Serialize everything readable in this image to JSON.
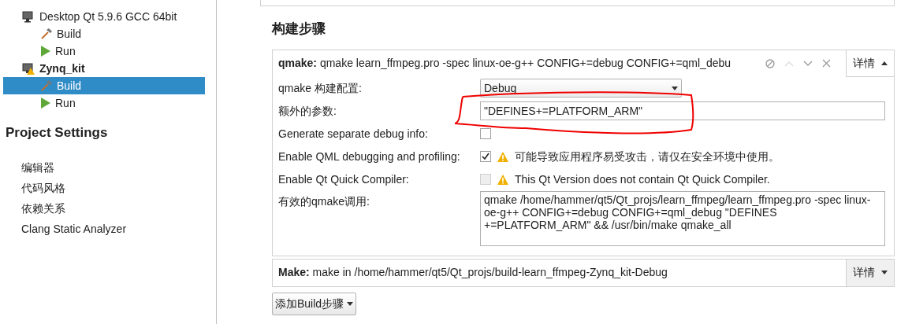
{
  "sidebar": {
    "kits": [
      {
        "name": "Desktop Qt 5.9.6 GCC 64bit",
        "warning": false,
        "bold": false,
        "children": [
          {
            "label": "Build",
            "kind": "build",
            "selected": false
          },
          {
            "label": "Run",
            "kind": "run",
            "selected": false
          }
        ]
      },
      {
        "name": "Zynq_kit",
        "warning": true,
        "bold": true,
        "children": [
          {
            "label": "Build",
            "kind": "build",
            "selected": true
          },
          {
            "label": "Run",
            "kind": "run",
            "selected": false
          }
        ]
      }
    ],
    "settings_title": "Project Settings",
    "settings_items": [
      {
        "label": "编辑器"
      },
      {
        "label": "代码风格"
      },
      {
        "label": "依赖关系"
      },
      {
        "label": "Clang Static Analyzer"
      }
    ]
  },
  "section_title": "构建步骤",
  "steps": [
    {
      "name": "qmake:",
      "summary": "qmake learn_ffmpeg.pro -spec linux-oe-g++ CONFIG+=debug CONFIG+=qml_debu",
      "details_label": "详情",
      "expanded": true,
      "rows": [
        {
          "kind": "select",
          "label": "qmake 构建配置:",
          "value": "Debug"
        },
        {
          "kind": "input",
          "label": "额外的参数:",
          "value": "\"DEFINES+=PLATFORM_ARM\""
        },
        {
          "kind": "checkbox",
          "label": "Generate separate debug info:",
          "checked": false,
          "disabled": false
        },
        {
          "kind": "checkbox",
          "label": "Enable QML debugging and profiling:",
          "checked": true,
          "disabled": false,
          "warning": "可能导致应用程序易受攻击，请仅在安全环境中使用。"
        },
        {
          "kind": "checkbox",
          "label": "Enable Qt Quick Compiler:",
          "checked": false,
          "disabled": true,
          "warning": "This Qt Version does not contain Qt Quick Compiler."
        },
        {
          "kind": "textarea",
          "label": "有效的qmake调用:",
          "value": "qmake /home/hammer/qt5/Qt_projs/learn_ffmpeg/learn_ffmpeg.pro -spec linux-oe-g++ CONFIG+=debug CONFIG+=qml_debug \"DEFINES +=PLATFORM_ARM\" && /usr/bin/make qmake_all"
        }
      ]
    },
    {
      "name": "Make:",
      "summary": "make in /home/hammer/qt5/Qt_projs/build-learn_ffmpeg-Zynq_kit-Debug",
      "details_label": "详情",
      "expanded": false
    }
  ],
  "add_button": "添加Build步骤"
}
